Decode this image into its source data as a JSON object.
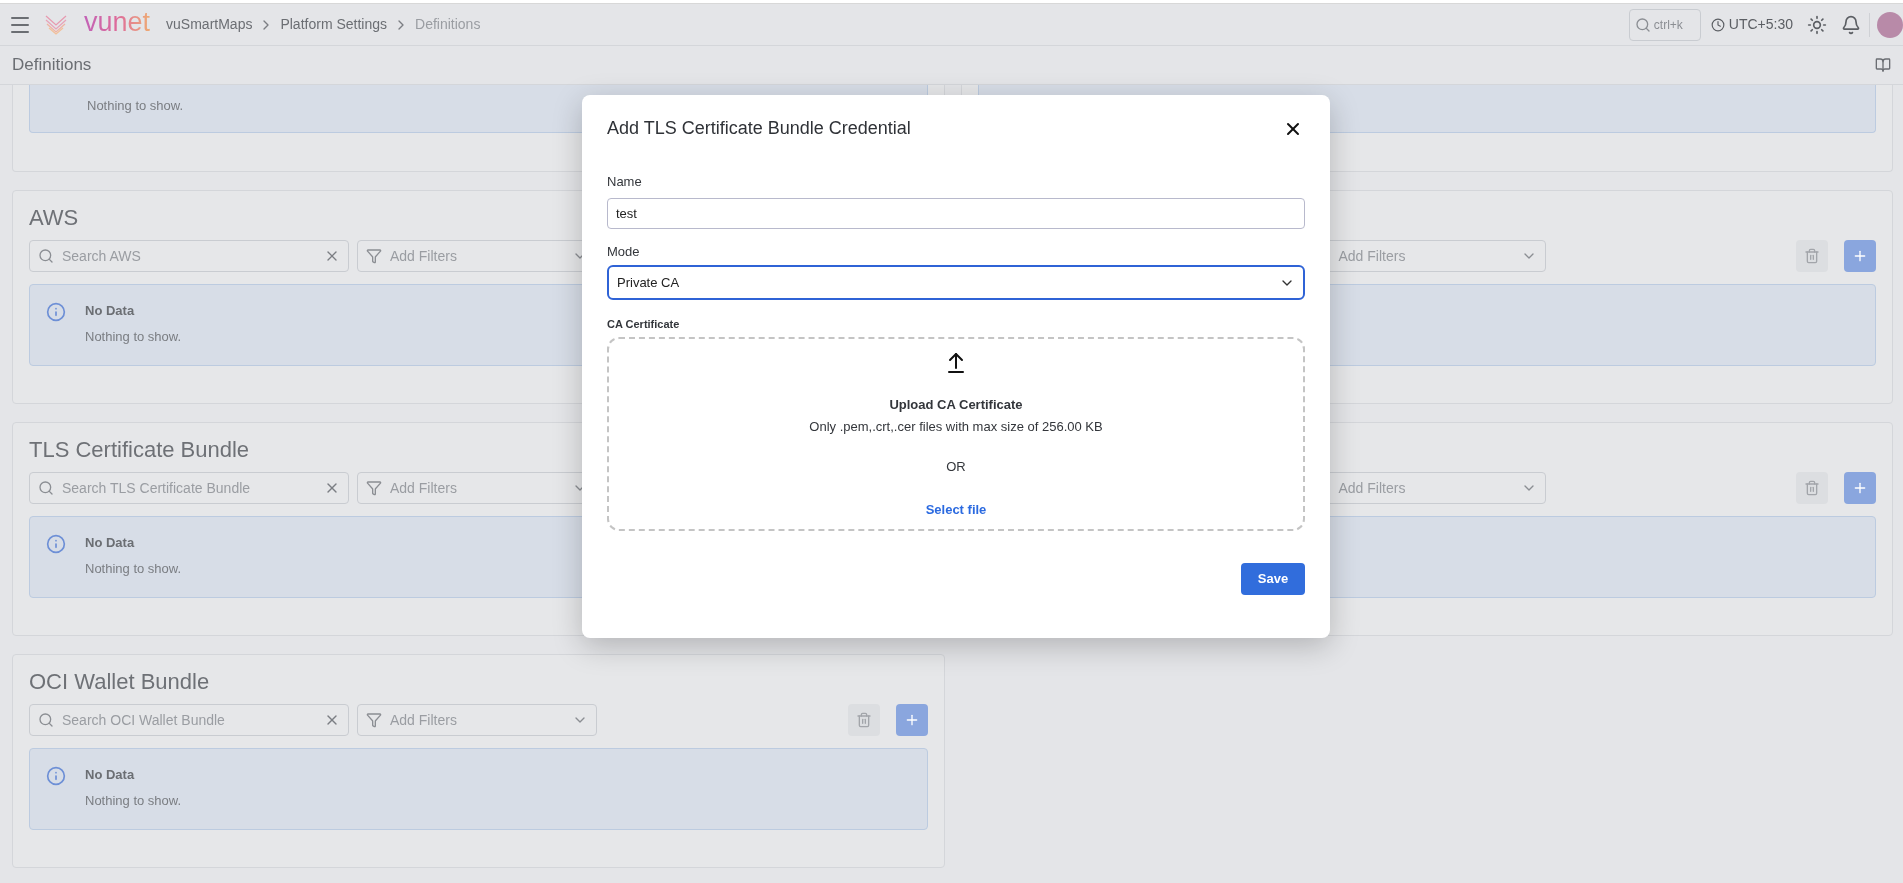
{
  "header": {
    "logo_text": "vunet",
    "breadcrumbs": [
      {
        "label": "vuSmartMaps",
        "current": false
      },
      {
        "label": "Platform Settings",
        "current": false
      },
      {
        "label": "Definitions",
        "current": true
      }
    ],
    "search": {
      "placeholder": "ctrl+k"
    },
    "timezone": "UTC+5:30"
  },
  "page_title": "Definitions",
  "panel_rows": [
    {
      "panels": [
        {
          "kind": "cut_off",
          "alert_message": "Nothing to show."
        },
        {
          "kind": "cut_off"
        }
      ]
    },
    {
      "panels": [
        {
          "kind": "full",
          "title": "AWS",
          "search": {
            "placeholder": "Search AWS"
          },
          "filter": {
            "placeholder": "Add Filters"
          },
          "alert_title": "No Data",
          "alert_message": "Nothing to show."
        },
        {
          "kind": "covered",
          "filter": {
            "placeholder": "Add Filters"
          }
        }
      ]
    },
    {
      "panels": [
        {
          "kind": "full",
          "title": "TLS Certificate Bundle",
          "search": {
            "placeholder": "Search TLS Certificate Bundle"
          },
          "filter": {
            "placeholder": "Add Filters"
          },
          "alert_title": "No Data",
          "alert_message": "Nothing to show."
        },
        {
          "kind": "covered",
          "filter": {
            "placeholder": "Add Filters"
          }
        }
      ]
    },
    {
      "panels": [
        {
          "kind": "full",
          "title": "OCI Wallet Bundle",
          "search": {
            "placeholder": "Search OCI Wallet Bundle"
          },
          "filter": {
            "placeholder": "Add Filters"
          },
          "alert_title": "No Data",
          "alert_message": "Nothing to show."
        }
      ]
    }
  ],
  "dialog": {
    "title": "Add TLS Certificate Bundle Credential",
    "name_field": {
      "label": "Name",
      "value": "test"
    },
    "mode_field": {
      "label": "Mode",
      "value": "Private CA"
    },
    "upload": {
      "label": "CA Certificate",
      "title": "Upload CA Certificate",
      "hint": "Only .pem,.crt,.cer files with max size of 256.00 KB",
      "separator": "OR",
      "link": "Select file"
    },
    "save_button": "Save"
  }
}
